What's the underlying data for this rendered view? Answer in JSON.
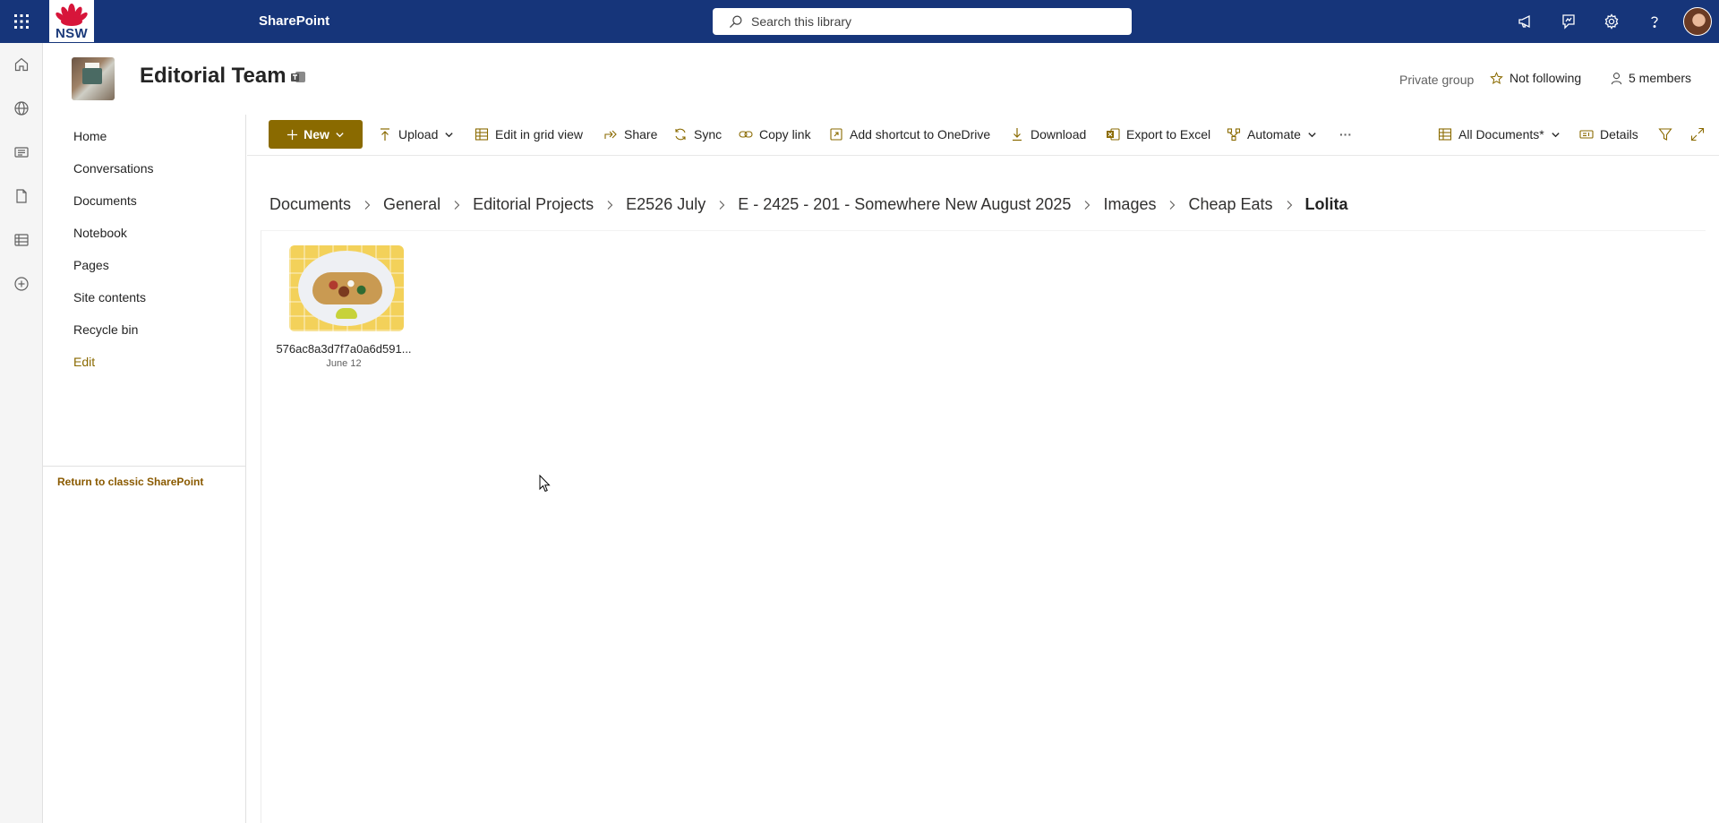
{
  "suitebar": {
    "logo_text": "NSW",
    "app_name": "SharePoint",
    "search_placeholder": "Search this library",
    "icons": [
      "waffle-icon",
      "megaphone-icon",
      "feedback-icon",
      "gear-icon",
      "help-icon",
      "avatar"
    ]
  },
  "appbar": {
    "items": [
      "home-icon",
      "globe-icon",
      "news-icon",
      "file-icon",
      "list-icon",
      "add-icon"
    ]
  },
  "site": {
    "title": "Editorial Team",
    "group_type": "Private group",
    "follow_label": "Not following",
    "members_label": "5 members"
  },
  "nav": {
    "items": [
      {
        "label": "Home"
      },
      {
        "label": "Conversations"
      },
      {
        "label": "Documents"
      },
      {
        "label": "Notebook"
      },
      {
        "label": "Pages"
      },
      {
        "label": "Site contents"
      },
      {
        "label": "Recycle bin"
      },
      {
        "label": "Edit"
      }
    ],
    "classic_link": "Return to classic SharePoint"
  },
  "commands": {
    "new": "New",
    "upload": "Upload",
    "grid": "Edit in grid view",
    "share": "Share",
    "sync": "Sync",
    "copy_link": "Copy link",
    "shortcut": "Add shortcut to OneDrive",
    "download": "Download",
    "export": "Export to Excel",
    "automate": "Automate",
    "more": "···",
    "view": "All Documents*",
    "details": "Details"
  },
  "breadcrumb": [
    "Documents",
    "General",
    "Editorial Projects",
    "E2526 July",
    "E - 2425 - 201 - Somewhere New August 2025",
    "Images",
    "Cheap Eats",
    "Lolita"
  ],
  "files": [
    {
      "name": "576ac8a3d7f7a0a6d591...",
      "date": "June 12"
    }
  ],
  "colors": {
    "suitebar": "#16357a",
    "accent": "#8a6a00"
  }
}
